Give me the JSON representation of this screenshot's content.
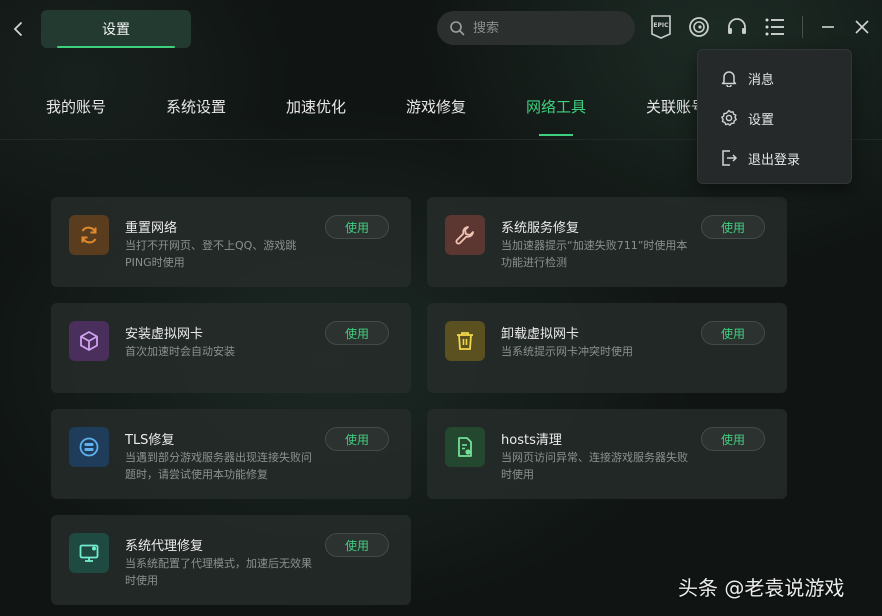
{
  "header": {
    "title_tab": "设置",
    "search_placeholder": "搜索"
  },
  "nav": {
    "tabs": [
      {
        "label": "我的账号",
        "active": false
      },
      {
        "label": "系统设置",
        "active": false
      },
      {
        "label": "加速优化",
        "active": false
      },
      {
        "label": "游戏修复",
        "active": false
      },
      {
        "label": "网络工具",
        "active": true
      },
      {
        "label": "关联账号",
        "active": false
      }
    ]
  },
  "tools": {
    "use_label": "使用",
    "items": [
      {
        "title": "重置网络",
        "desc": "当打不开网页、登不上QQ、游戏跳PING时使用",
        "icon": "refresh-icon",
        "color": "#c77a2a",
        "bg": "#5a3d1f"
      },
      {
        "title": "系统服务修复",
        "desc": "当加速器提示“加速失败711”时使用本功能进行检测",
        "icon": "wrench-icon",
        "color": "#e6b3a3",
        "bg": "#5c3630"
      },
      {
        "title": "安装虚拟网卡",
        "desc": "首次加速时会自动安装",
        "icon": "cube-icon",
        "color": "#c79ae8",
        "bg": "#4a2f5c"
      },
      {
        "title": "卸载虚拟网卡",
        "desc": "当系统提示网卡冲突时使用",
        "icon": "trash-icon",
        "color": "#e6cf45",
        "bg": "#5a5020"
      },
      {
        "title": "TLS修复",
        "desc": "当遇到部分游戏服务器出现连接失败问题时，请尝试使用本功能修复",
        "icon": "tls-icon",
        "color": "#5aa9e6",
        "bg": "#1f3d5a"
      },
      {
        "title": "hosts清理",
        "desc": "当网页访问异常、连接游戏服务器失败时使用",
        "icon": "file-clean-icon",
        "color": "#6fd68f",
        "bg": "#24482f"
      },
      {
        "title": "系统代理修复",
        "desc": "当系统配置了代理模式，加速后无效果时使用",
        "icon": "monitor-icon",
        "color": "#6fe0c8",
        "bg": "#1f4a42"
      }
    ]
  },
  "menu": {
    "items": [
      {
        "label": "消息",
        "icon": "bell-icon"
      },
      {
        "label": "设置",
        "icon": "gear-icon"
      },
      {
        "label": "退出登录",
        "icon": "logout-icon"
      }
    ]
  },
  "watermark": "头条 @老袁说游戏",
  "colors": {
    "accent": "#3fd07f",
    "background": "#101513",
    "card": "#262b29"
  }
}
